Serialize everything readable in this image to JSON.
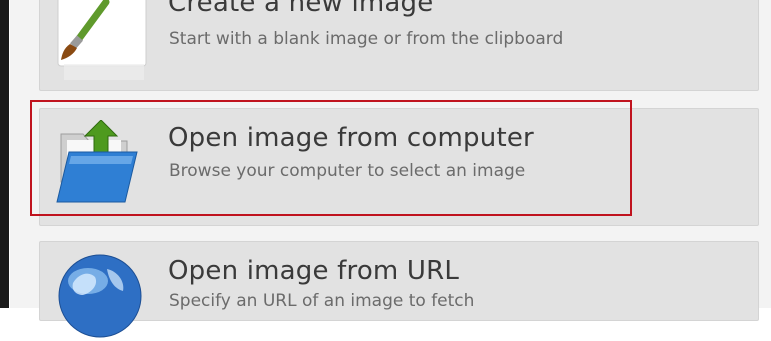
{
  "options": [
    {
      "title": "Create a new image",
      "subtitle": "Start with a blank image or from the clipboard",
      "icon": "paintbrush-icon"
    },
    {
      "title": "Open image from computer",
      "subtitle": "Browse your computer to select an image",
      "icon": "folder-upload-icon",
      "highlighted": true
    },
    {
      "title": "Open image from URL",
      "subtitle": "Specify an URL of an image to fetch",
      "icon": "globe-icon"
    }
  ],
  "colors": {
    "highlight_border": "#c0131e",
    "card_background": "#e2e2e2",
    "title_text": "#3a3a3a",
    "subtitle_text": "#6b6b6b"
  }
}
